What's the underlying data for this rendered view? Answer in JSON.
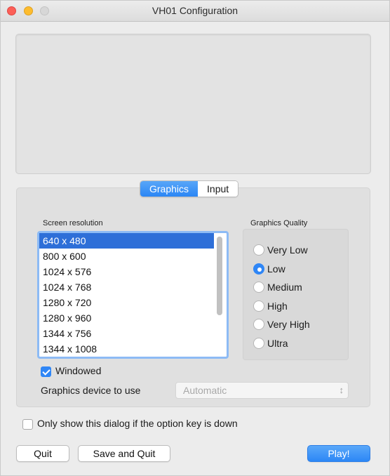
{
  "window": {
    "title": "VH01 Configuration"
  },
  "tabs": [
    {
      "label": "Graphics",
      "active": true
    },
    {
      "label": "Input",
      "active": false
    }
  ],
  "graphics": {
    "resolution_label": "Screen resolution",
    "resolutions": [
      "640 x 480",
      "800 x 600",
      "1024 x 576",
      "1024 x 768",
      "1280 x 720",
      "1280 x 960",
      "1344 x 756",
      "1344 x 1008"
    ],
    "selected_resolution": "640 x 480",
    "quality_label": "Graphics Quality",
    "quality_options": [
      "Very Low",
      "Low",
      "Medium",
      "High",
      "Very High",
      "Ultra"
    ],
    "selected_quality": "Low",
    "windowed_label": "Windowed",
    "windowed_checked": true,
    "device_label": "Graphics device to use",
    "device_value": "Automatic"
  },
  "option_key_label": "Only show this dialog if the option key is down",
  "option_key_checked": false,
  "buttons": {
    "quit": "Quit",
    "save_quit": "Save and Quit",
    "play": "Play!"
  },
  "colors": {
    "accent": "#2f86f6",
    "selection": "#2e6fd8"
  }
}
